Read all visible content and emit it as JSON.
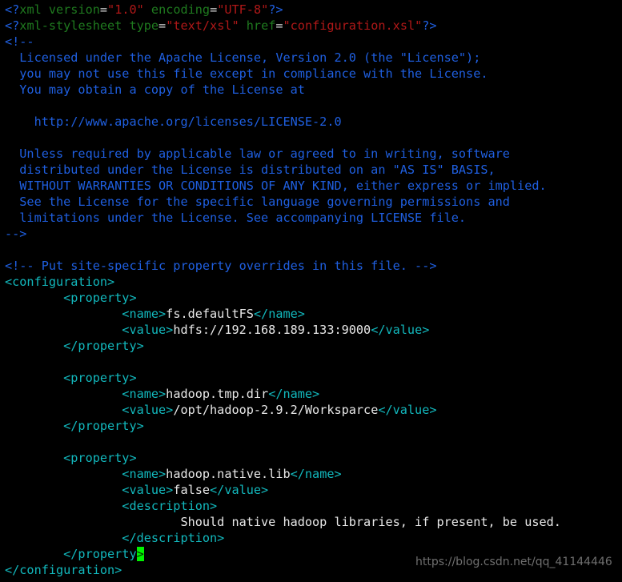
{
  "editor": {
    "background": "#000000",
    "filename_hint": "core-site.xml",
    "colors": {
      "declaration": "#1f5fe0",
      "declaration_name": "#1f7a1f",
      "attribute_value": "#b01818",
      "comment": "#1f5fe0",
      "tag": "#12b8bd",
      "text": "#e8e8e8",
      "cursor_block": "#00f200",
      "watermark": "#6f6f6f"
    },
    "cursor": {
      "character": ">",
      "line_index": 32,
      "column": 17
    }
  },
  "watermark": {
    "text": "https://blog.csdn.net/qq_41144446"
  },
  "lines": [
    [
      {
        "c": "t-decl",
        "t": "<?"
      },
      {
        "c": "t-tagname",
        "t": "xml "
      },
      {
        "c": "t-tagname",
        "t": "version"
      },
      {
        "c": "t-plain",
        "t": "="
      },
      {
        "c": "t-attrval",
        "t": "\"1.0\""
      },
      {
        "c": "t-plain",
        "t": " "
      },
      {
        "c": "t-tagname",
        "t": "encoding"
      },
      {
        "c": "t-plain",
        "t": "="
      },
      {
        "c": "t-attrval",
        "t": "\"UTF-8\""
      },
      {
        "c": "t-decl",
        "t": "?>"
      }
    ],
    [
      {
        "c": "t-decl",
        "t": "<?"
      },
      {
        "c": "t-tagname",
        "t": "xml-stylesheet "
      },
      {
        "c": "t-tagname",
        "t": "type"
      },
      {
        "c": "t-plain",
        "t": "="
      },
      {
        "c": "t-attrval",
        "t": "\"text/xsl\""
      },
      {
        "c": "t-plain",
        "t": " "
      },
      {
        "c": "t-tagname",
        "t": "href"
      },
      {
        "c": "t-plain",
        "t": "="
      },
      {
        "c": "t-attrval",
        "t": "\"configuration.xsl\""
      },
      {
        "c": "t-decl",
        "t": "?>"
      }
    ],
    [
      {
        "c": "t-comment",
        "t": "<!--"
      }
    ],
    [
      {
        "c": "t-comment",
        "t": "  Licensed under the Apache License, Version 2.0 (the \"License\");"
      }
    ],
    [
      {
        "c": "t-comment",
        "t": "  you may not use this file except in compliance with the License."
      }
    ],
    [
      {
        "c": "t-comment",
        "t": "  You may obtain a copy of the License at"
      }
    ],
    [
      {
        "c": "t-comment",
        "t": ""
      }
    ],
    [
      {
        "c": "t-comment",
        "t": "    http://www.apache.org/licenses/LICENSE-2.0"
      }
    ],
    [
      {
        "c": "t-comment",
        "t": ""
      }
    ],
    [
      {
        "c": "t-comment",
        "t": "  Unless required by applicable law or agreed to in writing, software"
      }
    ],
    [
      {
        "c": "t-comment",
        "t": "  distributed under the License is distributed on an \"AS IS\" BASIS,"
      }
    ],
    [
      {
        "c": "t-comment",
        "t": "  WITHOUT WARRANTIES OR CONDITIONS OF ANY KIND, either express or implied."
      }
    ],
    [
      {
        "c": "t-comment",
        "t": "  See the License for the specific language governing permissions and"
      }
    ],
    [
      {
        "c": "t-comment",
        "t": "  limitations under the License. See accompanying LICENSE file."
      }
    ],
    [
      {
        "c": "t-comment",
        "t": "-->"
      }
    ],
    [
      {
        "c": "t-comment",
        "t": ""
      }
    ],
    [
      {
        "c": "t-comment",
        "t": "<!-- Put site-specific property overrides in this file. -->"
      }
    ],
    [
      {
        "c": "t-tag",
        "t": "<configuration>"
      }
    ],
    [
      {
        "c": "t-tag",
        "t": "        <property>"
      }
    ],
    [
      {
        "c": "t-tag",
        "t": "                <name>"
      },
      {
        "c": "t-text",
        "t": "fs.defaultFS"
      },
      {
        "c": "t-tag",
        "t": "</name>"
      }
    ],
    [
      {
        "c": "t-tag",
        "t": "                <value>"
      },
      {
        "c": "t-text",
        "t": "hdfs://192.168.189.133:9000"
      },
      {
        "c": "t-tag",
        "t": "</value>"
      }
    ],
    [
      {
        "c": "t-tag",
        "t": "        </property>"
      }
    ],
    [
      {
        "c": "t-plain",
        "t": ""
      }
    ],
    [
      {
        "c": "t-tag",
        "t": "        <property>"
      }
    ],
    [
      {
        "c": "t-tag",
        "t": "                <name>"
      },
      {
        "c": "t-text",
        "t": "hadoop.tmp.dir"
      },
      {
        "c": "t-tag",
        "t": "</name>"
      }
    ],
    [
      {
        "c": "t-tag",
        "t": "                <value>"
      },
      {
        "c": "t-text",
        "t": "/opt/hadoop-2.9.2/Worksparce"
      },
      {
        "c": "t-tag",
        "t": "</value>"
      }
    ],
    [
      {
        "c": "t-tag",
        "t": "        </property>"
      }
    ],
    [
      {
        "c": "t-plain",
        "t": ""
      }
    ],
    [
      {
        "c": "t-tag",
        "t": "        <property>"
      }
    ],
    [
      {
        "c": "t-tag",
        "t": "                <name>"
      },
      {
        "c": "t-text",
        "t": "hadoop.native.lib"
      },
      {
        "c": "t-tag",
        "t": "</name>"
      }
    ],
    [
      {
        "c": "t-tag",
        "t": "                <value>"
      },
      {
        "c": "t-text",
        "t": "false"
      },
      {
        "c": "t-tag",
        "t": "</value>"
      }
    ],
    [
      {
        "c": "t-tag",
        "t": "                <description>"
      }
    ],
    [
      {
        "c": "t-text",
        "t": "                        Should native hadoop libraries, if present, be used."
      }
    ],
    [
      {
        "c": "t-tag",
        "t": "                </description>"
      }
    ],
    [
      {
        "c": "t-tag",
        "t": "        </property"
      },
      {
        "c": "t-tag cursor",
        "t": ">"
      }
    ],
    [
      {
        "c": "t-tag",
        "t": "</configuration>"
      }
    ]
  ]
}
